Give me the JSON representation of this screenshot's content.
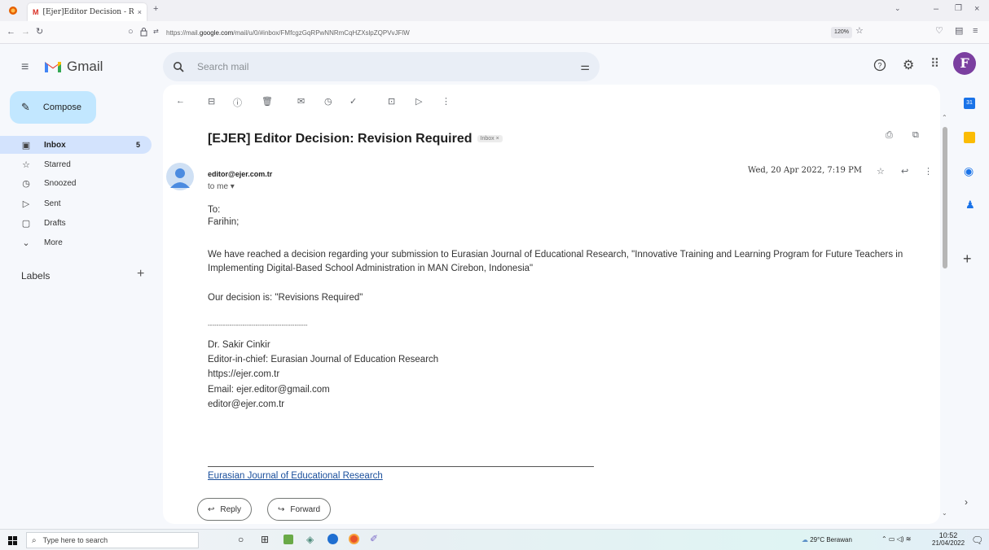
{
  "browser": {
    "tab_title": "[Ejer]Editor Decision - Revi",
    "url_prefix": "https://mail.",
    "url_domain": "google.com",
    "url_rest": "/mail/u/0/#inbox/FMfcgzGqRPwNNRmCqHZXslpZQPVvJFlW",
    "zoom": "120%"
  },
  "gmail": {
    "app_name": "Gmail",
    "search_placeholder": "Search mail",
    "avatar_letter": "F",
    "compose_label": "Compose",
    "labels_heading": "Labels"
  },
  "sidebar": {
    "items": [
      {
        "label": "Inbox",
        "count": "5",
        "icon": "inbox-icon"
      },
      {
        "label": "Starred",
        "count": "",
        "icon": "star-icon"
      },
      {
        "label": "Snoozed",
        "count": "",
        "icon": "clock-icon"
      },
      {
        "label": "Sent",
        "count": "",
        "icon": "send-icon"
      },
      {
        "label": "Drafts",
        "count": "",
        "icon": "draft-icon"
      },
      {
        "label": "More",
        "count": "",
        "icon": "chevron-down-icon"
      }
    ]
  },
  "email": {
    "subject": "[EJER] Editor Decision: Revision Required",
    "inbox_chip": "Inbox ×",
    "sender": "editor@ejer.com.tr",
    "to_me": "to me ▾",
    "date": "Wed, 20 Apr 2022,  7:19 PM",
    "body": {
      "to": "To:",
      "name": "Farihin;",
      "para1_line1": "We have reached a decision regarding your submission to Eurasian Journal of Educational Research, \"Innovative Training and Learning Program for Future Teachers in",
      "para1_line2": "Implementing Digital-Based School Administration in MAN Cirebon, Indonesia\"",
      "decision": "Our decision is: \"Revisions Required\"",
      "separator": "----------------------------------------------",
      "sig_name": "Dr. Sakir Cinkir",
      "sig_title": "Editor-in-chief: Eurasian Journal of Education Research",
      "sig_url": "https://ejer.com.tr",
      "sig_email": "Email: ejer.editor@gmail.com",
      "sig_email2": "editor@ejer.com.tr",
      "footer_link": "Eurasian Journal of Educational Research"
    },
    "reply_label": "Reply",
    "forward_label": "Forward"
  },
  "taskbar": {
    "search_placeholder": "Type here to search",
    "weather": "29°C  Berawan",
    "time": "10:52",
    "date": "21/04/2022"
  },
  "colors": {
    "gmail_bg": "#f6f8fc",
    "compose_bg": "#c2e7ff",
    "active_nav": "#d3e3fd",
    "avatar": "#7b3fa0",
    "link": "#1a4f9c"
  }
}
